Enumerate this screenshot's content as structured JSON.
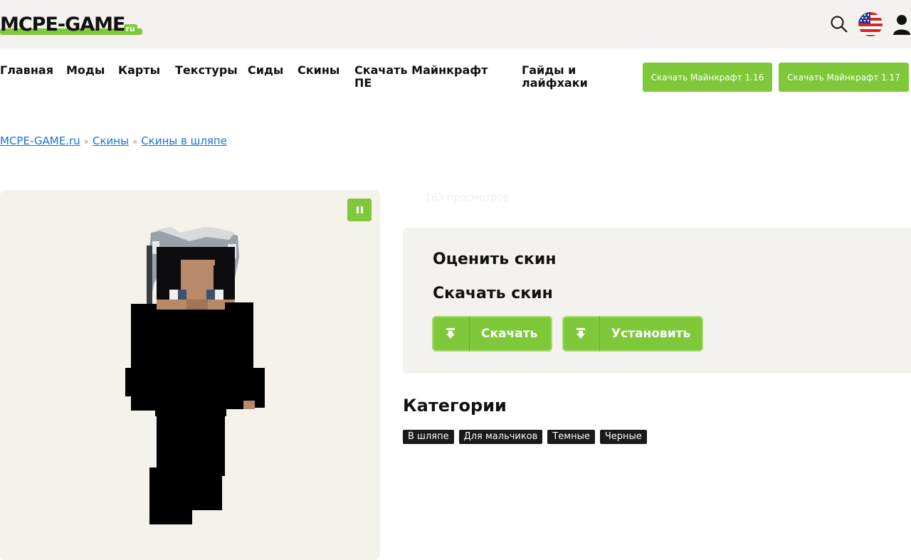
{
  "header": {
    "logo_text": "MCPE-GAME",
    "logo_suffix": "ru",
    "icons": [
      "search-icon",
      "us-flag-icon",
      "user-icon"
    ]
  },
  "nav": {
    "items": [
      "Главная",
      "Моды",
      "Карты",
      "Текстуры",
      "Сиды",
      "Скины",
      "Скачать Майнкрафт ПЕ",
      "Гайды и лайфхаки"
    ],
    "download_buttons": [
      "Скачать Майнкрафт 1.16",
      "Скачать Майнкрафт 1.17"
    ]
  },
  "breadcrumb": {
    "items": [
      "MCPE-GAME.ru",
      "Скины",
      "Скины в шляпе"
    ],
    "separator": "»"
  },
  "viewer": {
    "pause_icon": "pause-icon"
  },
  "skin_info": {
    "views": "163 просмотров",
    "rate_title": "Оценить скин",
    "download_title": "Скачать скин",
    "download_label": "Скачать",
    "install_label": "Установить"
  },
  "categories": {
    "title": "Категории",
    "tags": [
      "В шляпе",
      "Для мальчиков",
      "Темные",
      "Черные"
    ]
  },
  "colors": {
    "accent": "#7ec83a",
    "header_bg": "#f4f2ee",
    "link": "#1e6fd6",
    "tag_bg": "#1a1a1a"
  }
}
